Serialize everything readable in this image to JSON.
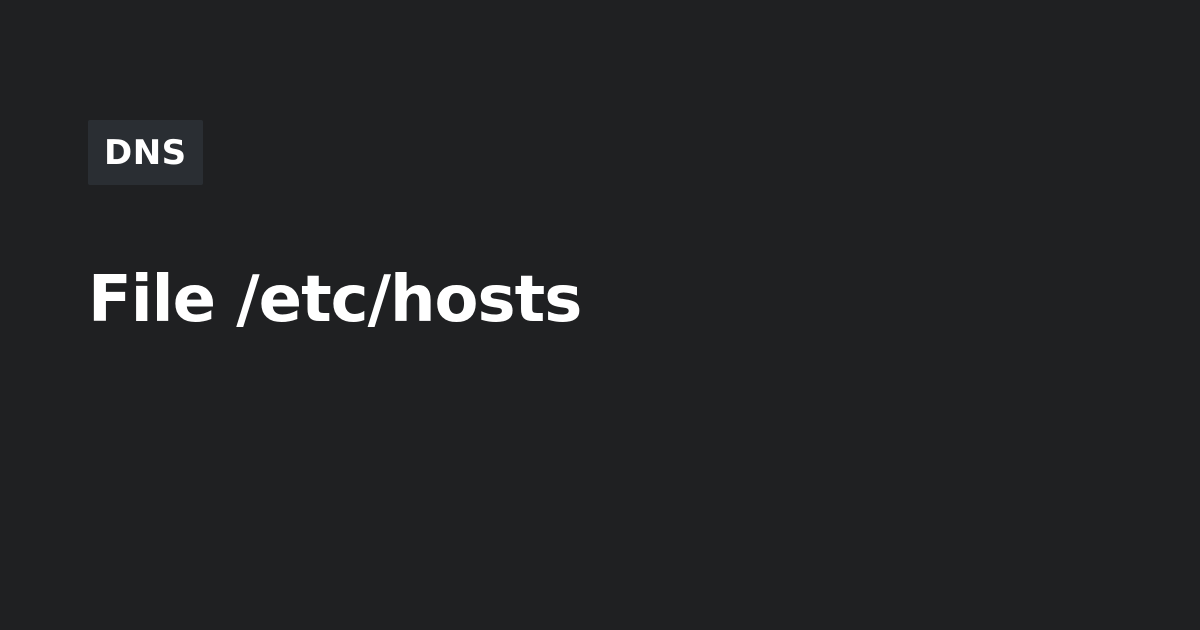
{
  "tag": {
    "label": "DNS"
  },
  "title": "File /etc/hosts",
  "colors": {
    "background": "#1f2022",
    "tag_background": "#2a2e33",
    "text": "#ffffff"
  }
}
